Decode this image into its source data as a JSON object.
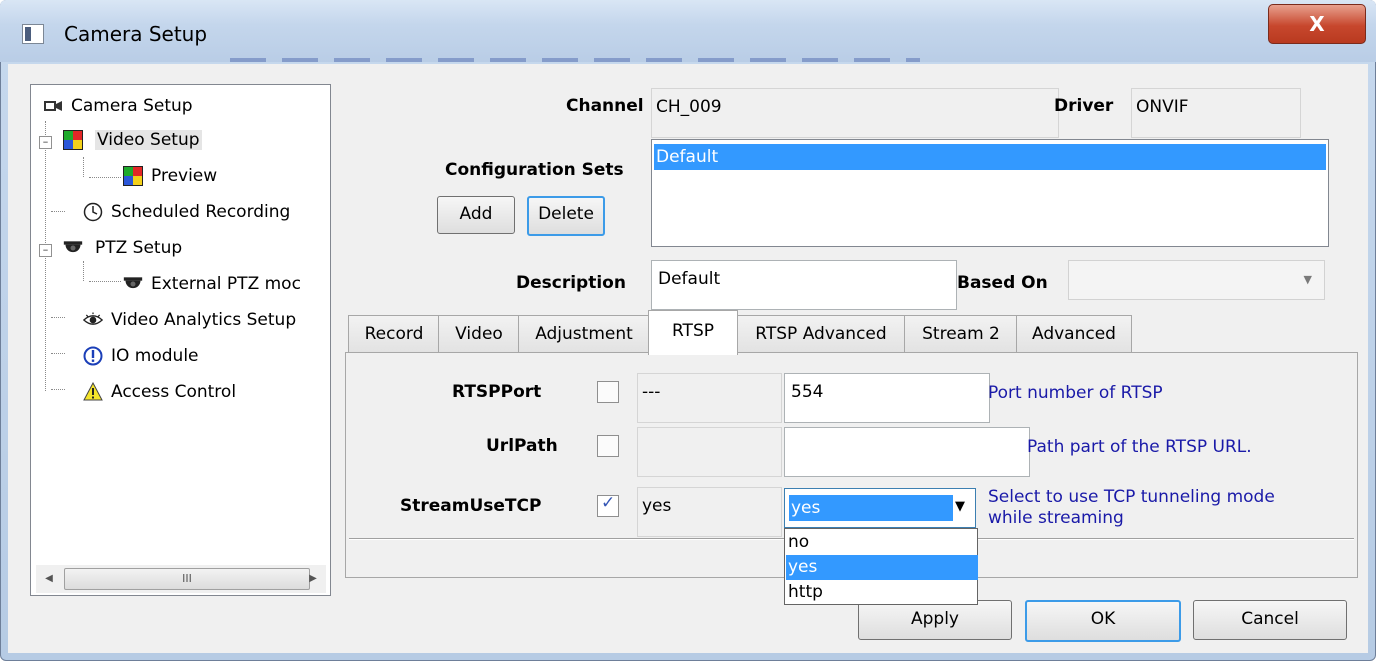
{
  "window": {
    "title": "Camera Setup",
    "close_glyph": "X"
  },
  "tree": {
    "items": [
      {
        "label": "Camera Setup",
        "icon": "camera-icon"
      },
      {
        "label": "Video Setup",
        "icon": "video-setup-icon"
      },
      {
        "label": "Preview",
        "icon": "preview-icon"
      },
      {
        "label": "Scheduled Recording",
        "icon": "clock-icon"
      },
      {
        "label": "PTZ Setup",
        "icon": "dome-camera-icon"
      },
      {
        "label": "External PTZ moc",
        "icon": "dome-camera-icon"
      },
      {
        "label": "Video Analytics Setup",
        "icon": "eye-icon"
      },
      {
        "label": "IO module",
        "icon": "info-circle-icon"
      },
      {
        "label": "Access Control",
        "icon": "warning-icon"
      }
    ],
    "scroll_thumb": "III"
  },
  "form": {
    "channel_label": "Channel",
    "channel_value": "CH_009",
    "driver_label": "Driver",
    "driver_value": "ONVIF",
    "config_sets_label": "Configuration Sets",
    "add_label": "Add",
    "delete_label": "Delete",
    "config_sets": [
      "Default"
    ],
    "description_label": "Description",
    "description_value": "Default",
    "based_on_label": "Based On",
    "based_on_value": ""
  },
  "tabs": [
    "Record",
    "Video",
    "Adjustment",
    "RTSP",
    "RTSP Advanced",
    "Stream 2",
    "Advanced"
  ],
  "active_tab": "RTSP",
  "rtsp": {
    "rows": [
      {
        "label": "RTSPPort",
        "checked": false,
        "current": "---",
        "value": "554",
        "hint": "Port number of RTSP"
      },
      {
        "label": "UrlPath",
        "checked": false,
        "current": "",
        "value": "",
        "hint": "Path part of the RTSP URL."
      },
      {
        "label": "StreamUseTCP",
        "checked": true,
        "current": "yes",
        "value": "yes",
        "hint_line1": "Select to use TCP tunneling mode",
        "hint_line2": "while streaming"
      }
    ],
    "dropdown_options": [
      "no",
      "yes",
      "http"
    ],
    "dropdown_selected": "yes"
  },
  "footer": {
    "apply_label": "Apply",
    "ok_label": "OK",
    "cancel_label": "Cancel"
  },
  "colors": {
    "selection": "#3399ff",
    "hint_text": "#1a1aa8",
    "close_button": "#c7472d"
  }
}
